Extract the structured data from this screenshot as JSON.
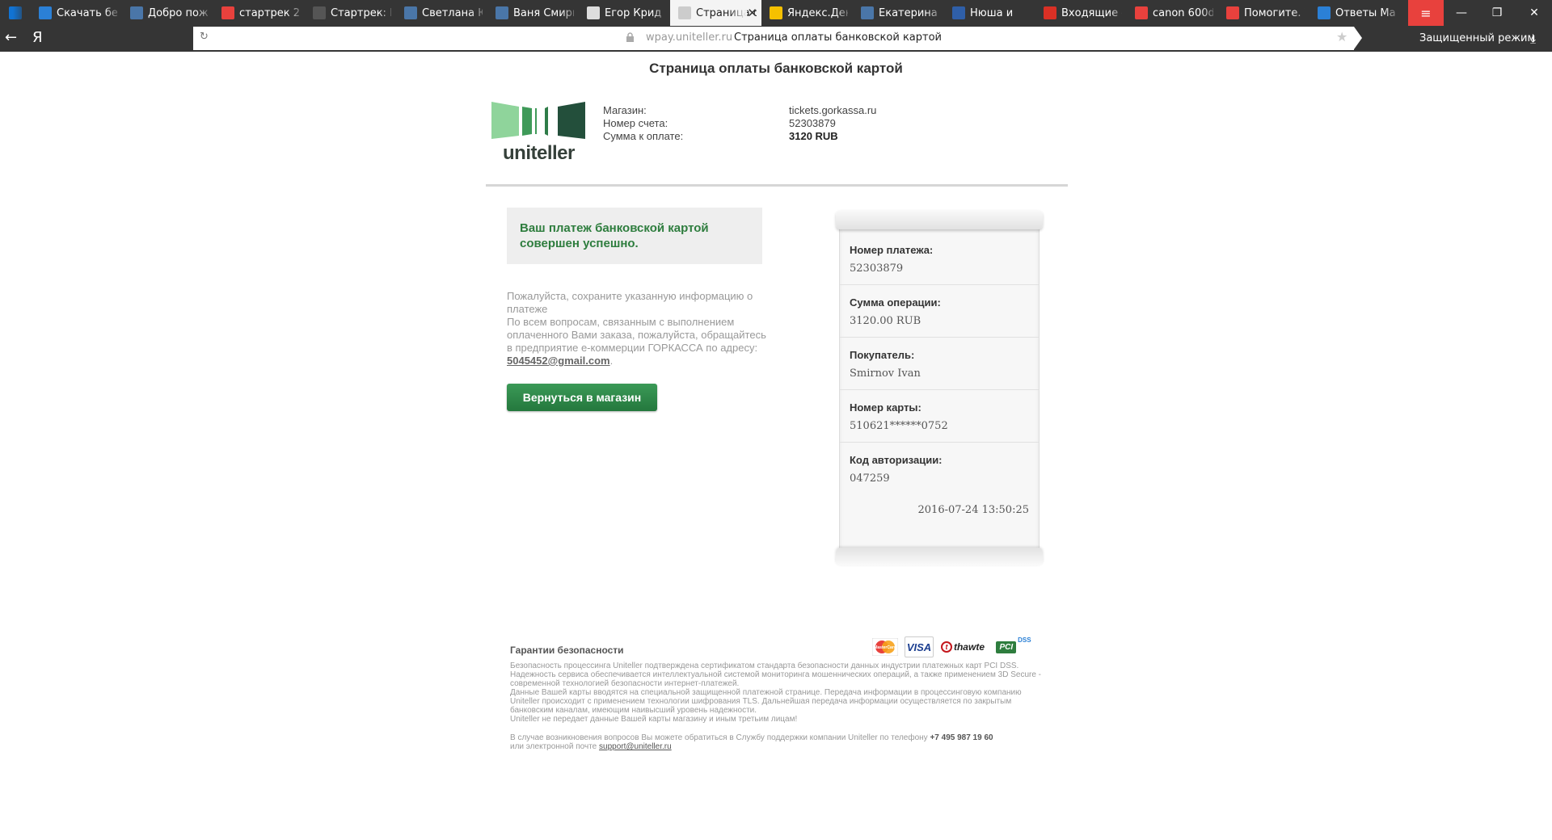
{
  "browser": {
    "tabs": [
      {
        "title": "",
        "icon": "hp-icon",
        "color": "#1173d4"
      },
      {
        "title": "Скачать бесплатно",
        "icon": "shield-icon",
        "color": "#2b80d6"
      },
      {
        "title": "Добро пожаловать",
        "icon": "vk-icon",
        "color": "#4a76a8"
      },
      {
        "title": "стартрек 2",
        "icon": "yandex-icon",
        "color": "#e8413d"
      },
      {
        "title": "Стартрек: Возмездие",
        "icon": "avatar-icon",
        "color": "#555555"
      },
      {
        "title": "Светлана Ю",
        "icon": "vk-icon",
        "color": "#4a76a8"
      },
      {
        "title": "Ваня Смирнов",
        "icon": "vk-icon",
        "color": "#4a76a8"
      },
      {
        "title": "Егор Крид (Creed)",
        "icon": "image-icon",
        "color": "#dddddd"
      },
      {
        "title": "Страница оплаты",
        "icon": "page-icon",
        "color": "#cccccc",
        "active": true
      },
      {
        "title": "Яндекс.Деньги",
        "icon": "wallet-icon",
        "color": "#f5c000"
      },
      {
        "title": "Екатерина С",
        "icon": "vk-icon",
        "color": "#4a76a8"
      },
      {
        "title": "Нюша и",
        "icon": "play-icon",
        "color": "#2f5fa8",
        "audio": true
      },
      {
        "title": "Входящие - Почта",
        "icon": "mail-icon",
        "color": "#d93025"
      },
      {
        "title": "canon 600d",
        "icon": "yandex-icon",
        "color": "#e8413d"
      },
      {
        "title": "Помогите. У",
        "icon": "c-icon",
        "color": "#e8413d"
      },
      {
        "title": "Ответы Mail.Ru",
        "icon": "question-icon",
        "color": "#2b80d6"
      }
    ],
    "new_tab": "+",
    "menu": "≡",
    "minimize": "—",
    "restore": "❐",
    "close": "✕",
    "back": "←",
    "logo": "Я",
    "reload": "↻",
    "domain": "wpay.uniteller.ru",
    "address_title": "Страница оплаты банковской картой",
    "star": "★",
    "protected_mode": "Защищенный режим",
    "download": "⤓"
  },
  "page": {
    "title": "Страница оплаты банковской картой",
    "logo_word": "uniteller",
    "shop": {
      "labels": [
        "Магазин:",
        "Номер счета:",
        "Сумма к оплате:"
      ],
      "values": [
        "tickets.gorkassa.ru",
        "52303879",
        "3120 RUB"
      ]
    },
    "success_message": "Ваш платеж банковской картой совершен успешно.",
    "note": {
      "line1": "Пожалуйста, сохраните указанную информацию о платеже",
      "line2": "По всем вопросам, связанным с выполнением оплаченного Вами заказа, пожалуйста, обращайтесь в предприятие е-коммерции ГОРКАССА по адресу:",
      "email": "5045452@gmail.com",
      "dot": "."
    },
    "return_button": "Вернуться в магазин",
    "receipt": {
      "items": [
        {
          "label": "Номер платежа:",
          "value": "52303879"
        },
        {
          "label": "Сумма операции:",
          "value": "3120.00 RUB"
        },
        {
          "label": "Покупатель:",
          "value": "Smirnov Ivan"
        },
        {
          "label": "Номер карты:",
          "value": "510621******0752"
        },
        {
          "label": "Код авторизации:",
          "value": "047259"
        }
      ],
      "datetime": "2016-07-24 13:50:25"
    },
    "security": {
      "title": "Гарантии безопасности",
      "text1": "Безопасность процессинга Uniteller подтверждена сертификатом стандарта безопасности данных индустрии платежных карт PCI DSS. Надежность сервиса обеспечивается интеллектуальной системой мониторинга мошеннических операций, а также применением 3D Secure - современной технологией безопасности интернет-платежей.",
      "text2": "Данные Вашей карты вводятся на специальной защищенной платежной странице. Передача информации в процессинговую компанию Uniteller происходит с применением технологии шифрования TLS. Дальнейшая передача информации осуществляется по закрытым банковским каналам, имеющим наивысший уровень надежности.",
      "text3": "Uniteller не передает данные Вашей карты магазину и иным третьим лицам!",
      "contact_prefix": "В случае возникновения вопросов Вы можете обратиться в Службу поддержки компании Uniteller по телефону",
      "phone": "+7 495 987 19 60",
      "contact_mid": "или электронной почте",
      "support_email": "support@uniteller.ru",
      "badges": {
        "mastercard": "MasterCard",
        "visa": "VISA",
        "thawte": "thawte",
        "pci": "PCI",
        "dss": "DSS"
      }
    }
  }
}
